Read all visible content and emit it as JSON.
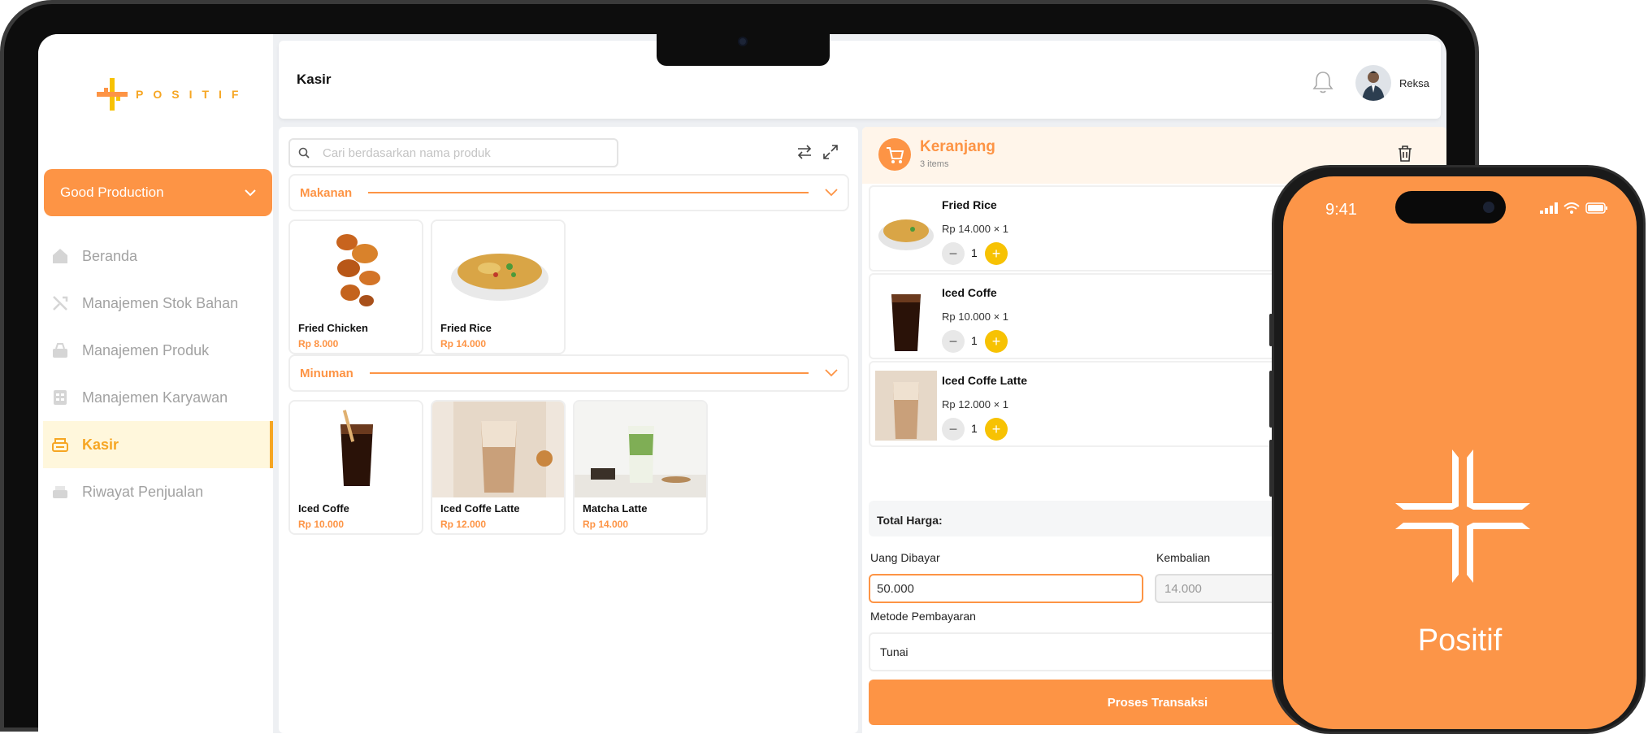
{
  "brand": {
    "logo_text": "POSITIF"
  },
  "page": {
    "title": "Kasir"
  },
  "header": {
    "user_name": "Reksa"
  },
  "sidebar": {
    "outlet": "Good Production",
    "items": [
      {
        "label": "Beranda",
        "icon": "home-icon"
      },
      {
        "label": "Manajemen Stok Bahan",
        "icon": "stock-icon"
      },
      {
        "label": "Manajemen Produk",
        "icon": "product-icon"
      },
      {
        "label": "Manajemen Karyawan",
        "icon": "employee-icon"
      },
      {
        "label": "Kasir",
        "icon": "cashier-icon",
        "active": true
      },
      {
        "label": "Riwayat Penjualan",
        "icon": "history-icon"
      }
    ]
  },
  "search": {
    "placeholder": "Cari berdasarkan nama produk"
  },
  "categories": [
    {
      "name": "Makanan",
      "products": [
        {
          "name": "Fried Chicken",
          "price": "Rp 8.000"
        },
        {
          "name": "Fried Rice",
          "price": "Rp 14.000"
        }
      ]
    },
    {
      "name": "Minuman",
      "products": [
        {
          "name": "Iced Coffe",
          "price": "Rp 10.000"
        },
        {
          "name": "Iced Coffe Latte",
          "price": "Rp 12.000"
        },
        {
          "name": "Matcha Latte",
          "price": "Rp 14.000"
        }
      ]
    }
  ],
  "cart": {
    "title": "Keranjang",
    "count": "3 items",
    "items": [
      {
        "name": "Fried Rice",
        "price": "Rp 14.000 × 1",
        "qty": "1"
      },
      {
        "name": "Iced Coffe",
        "price": "Rp 10.000 × 1",
        "qty": "1"
      },
      {
        "name": "Iced Coffe Latte",
        "price": "Rp 12.000 × 1",
        "qty": "1"
      }
    ]
  },
  "payment": {
    "total_label": "Total Harga:",
    "paid_label": "Uang Dibayar",
    "paid_value": "50.000",
    "change_label": "Kembalian",
    "change_value": "14.000",
    "method_label": "Metode Pembayaran",
    "method_value": "Tunai",
    "submit_label": "Proses Transaksi"
  },
  "phone": {
    "time": "9:41",
    "app_name": "Positif"
  },
  "colors": {
    "accent": "#fd9445",
    "brand_yellow": "#f7c203",
    "active_bg": "#fff7dc"
  }
}
